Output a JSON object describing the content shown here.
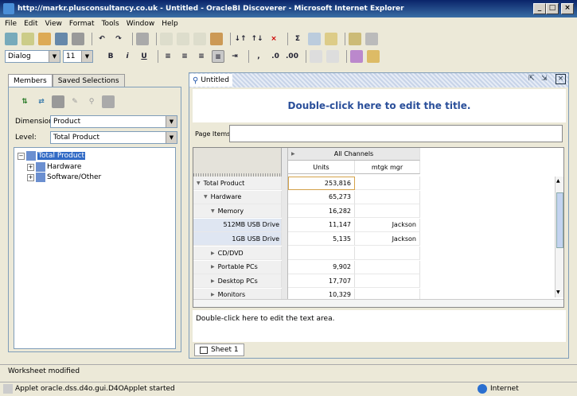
{
  "window": {
    "title": "http://markr.plusconsultancy.co.uk - Untitled - OracleBI Discoverer - Microsoft Internet Explorer"
  },
  "menu": [
    "File",
    "Edit",
    "View",
    "Format",
    "Tools",
    "Window",
    "Help"
  ],
  "format_bar": {
    "font": "Dialog",
    "size": "11",
    "bold": "B",
    "italic": "i",
    "underline": "U"
  },
  "left_panel": {
    "tabs": [
      "Members",
      "Saved Selections"
    ],
    "dimension_label": "Dimension:",
    "dimension_value": "Product",
    "level_label": "Level:",
    "level_value": "Total Product",
    "tree": [
      {
        "label": "Total Product",
        "selected": true
      },
      {
        "label": "Hardware"
      },
      {
        "label": "Software/Other"
      }
    ]
  },
  "worksheet": {
    "tab_title": "Untitled",
    "title_placeholder": "Double-click here to edit the title.",
    "page_items_label": "Page Items",
    "column_group": "All Channels",
    "col1": "Units",
    "col2": "mtgk mgr",
    "rows": [
      {
        "label": "Total Product",
        "units": "253,816",
        "mgr": "",
        "indent": 0,
        "expand": "down"
      },
      {
        "label": "Hardware",
        "units": "65,273",
        "mgr": "",
        "indent": 1,
        "expand": "down"
      },
      {
        "label": "Memory",
        "units": "16,282",
        "mgr": "",
        "indent": 2,
        "expand": "down"
      },
      {
        "label": "512MB USB Drive",
        "units": "11,147",
        "mgr": "Jackson",
        "indent": 3,
        "expand": ""
      },
      {
        "label": "1GB USB Drive",
        "units": "5,135",
        "mgr": "Jackson",
        "indent": 3,
        "expand": ""
      },
      {
        "label": "CD/DVD",
        "units": "",
        "mgr": "",
        "indent": 2,
        "expand": "right"
      },
      {
        "label": "Portable PCs",
        "units": "9,902",
        "mgr": "",
        "indent": 2,
        "expand": "right"
      },
      {
        "label": "Desktop PCs",
        "units": "17,707",
        "mgr": "",
        "indent": 2,
        "expand": "right"
      },
      {
        "label": "Monitors",
        "units": "10,329",
        "mgr": "",
        "indent": 2,
        "expand": "right"
      }
    ],
    "text_area": "Double-click here to edit the text area.",
    "sheet_tab": "Sheet 1"
  },
  "status": {
    "message": "Worksheet modified",
    "applet": "Applet oracle.dss.d4o.gui.D4OApplet started",
    "zone": "Internet"
  }
}
